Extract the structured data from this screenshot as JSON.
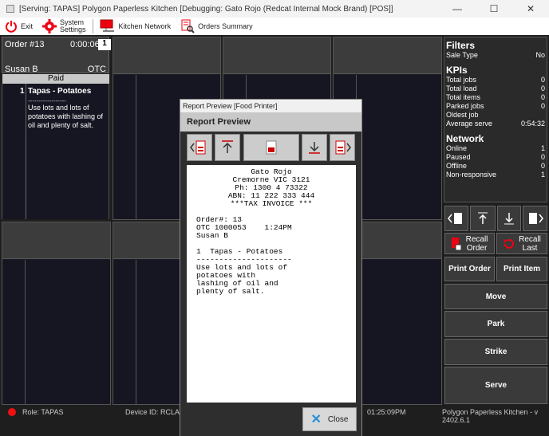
{
  "window": {
    "title": "[Serving: TAPAS] Polygon Paperless Kitchen [Debugging: Gato Rojo (Redcat Internal Mock Brand)  [POS]]",
    "minimize": "—",
    "maximize": "☐",
    "close": "✕"
  },
  "toolbar": {
    "exit": "Exit",
    "system_settings_line1": "System",
    "system_settings_line2": "Settings",
    "kitchen_network": "Kitchen Network",
    "orders_summary": "Orders Summary"
  },
  "order": {
    "number": "Order #13",
    "timer": "0:00:06",
    "count": "1",
    "customer": "Susan B",
    "channel": "OTC",
    "status": "Paid",
    "item_qty": "1",
    "item_name": "Tapas - Potatoes",
    "item_separator": "------------------",
    "item_note": "Use lots and lots of potatoes with lashing of oil and plenty of salt."
  },
  "right_panel": {
    "filters_title": "Filters",
    "sale_type_label": "Sale Type",
    "sale_type_value": "No",
    "kpis_title": "KPIs",
    "kpis": [
      {
        "label": "Total jobs",
        "value": "0"
      },
      {
        "label": "Total load",
        "value": "0"
      },
      {
        "label": "Total items",
        "value": "0"
      },
      {
        "label": "Parked jobs",
        "value": "0"
      },
      {
        "label": "Oldest job",
        "value": ""
      },
      {
        "label": "Average serve",
        "value": "0:54:32"
      }
    ],
    "network_title": "Network",
    "network": [
      {
        "label": "Online",
        "value": "1"
      },
      {
        "label": "Paused",
        "value": "0"
      },
      {
        "label": "Offline",
        "value": "0"
      },
      {
        "label": "Non-responsive",
        "value": "1"
      }
    ]
  },
  "buttons": {
    "recall_order": "Recall Order",
    "recall_last": "Recall Last",
    "print_order": "Print Order",
    "print_item": "Print Item",
    "move": "Move",
    "park": "Park",
    "strike": "Strike",
    "serve": "Serve"
  },
  "statusbar": {
    "role": "Role: TAPAS",
    "device": "Device ID: RCLAP86",
    "time": "01:25:09PM",
    "version": "Polygon Paperless Kitchen - v 2402.6.1"
  },
  "dialog": {
    "title": "Report Preview  [Food Printer]",
    "heading": "Report Preview",
    "close": "Close",
    "receipt": {
      "line1": "Gato Rojo",
      "line2": "Cremorne VIC 3121",
      "line3": "Ph: 1300 4 73322",
      "line4": "ABN: 11 222 333 444",
      "line5": "***TAX INVOICE ***",
      "order_line": "Order#: 13",
      "otc_line": "OTC 1000053    1:24PM",
      "cust_line": "Susan B",
      "item_line": "1  Tapas - Potatoes",
      "sep_line": "---------------------",
      "note1": "Use lots and lots of",
      "note2": "potatoes with",
      "note3": "lashing of oil and",
      "note4": "plenty of salt."
    }
  },
  "colors": {
    "accent_red": "#e11",
    "close_blue": "#2a8fd6"
  }
}
